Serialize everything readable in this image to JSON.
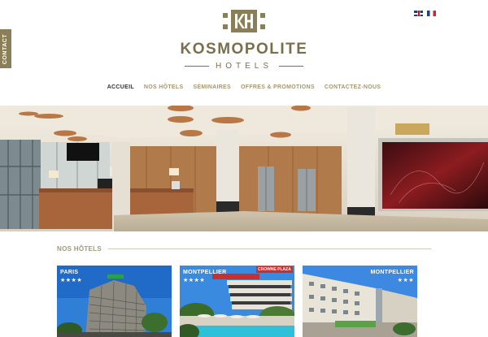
{
  "contact_tab": {
    "label": "CONTACT"
  },
  "languages": [
    {
      "code": "en",
      "icon": "uk-flag-icon"
    },
    {
      "code": "fr",
      "icon": "fr-flag-icon"
    }
  ],
  "brand": {
    "monogram": "KH",
    "name": "KOSMOPOLITE",
    "subtitle": "HOTELS",
    "color": "#7a6f4d"
  },
  "nav": {
    "items": [
      {
        "label": "ACCUEIL",
        "active": true
      },
      {
        "label": "NOS HÔTELS",
        "active": false
      },
      {
        "label": "SÉMINAIRES",
        "active": false
      },
      {
        "label": "OFFRES & PROMOTIONS",
        "active": false
      },
      {
        "label": "CONTACTEZ-NOUS",
        "active": false
      }
    ]
  },
  "section": {
    "title": "NOS HÔTELS"
  },
  "hotels": [
    {
      "city": "PARIS",
      "stars": "★★★★",
      "brand_badge": "Holiday Inn"
    },
    {
      "city": "MONTPELLIER",
      "stars": "★★★★",
      "brand_badge": "CROWNE PLAZA"
    },
    {
      "city": "MONTPELLIER",
      "stars": "★★★",
      "brand_badge": ""
    }
  ],
  "colors": {
    "accent": "#a39872",
    "gold": "#8a7f57"
  }
}
